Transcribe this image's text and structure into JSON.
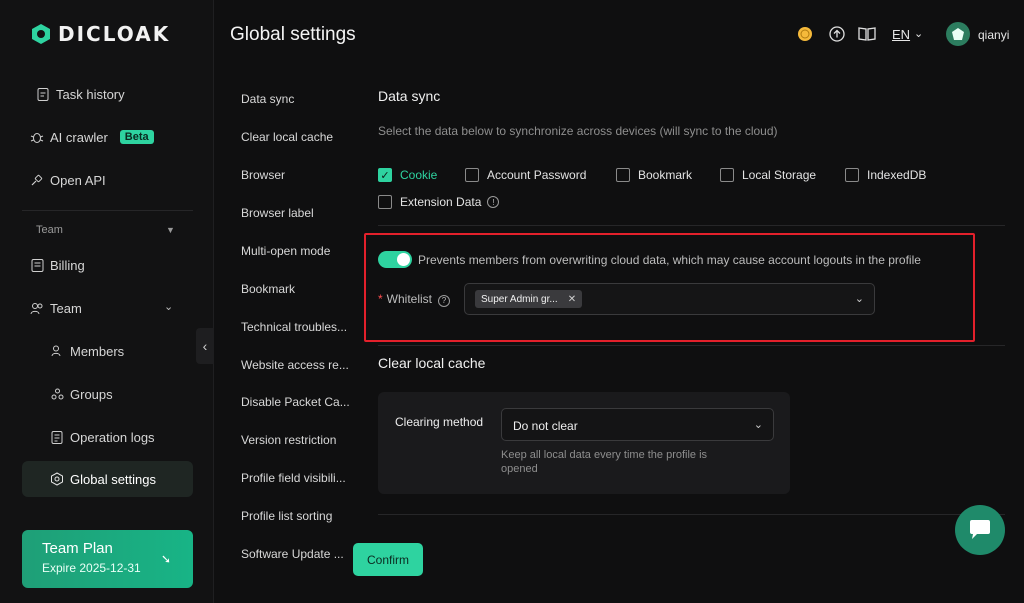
{
  "app": {
    "logo_text": "DICLOAK"
  },
  "sidebar": {
    "items": [
      {
        "label": "Task history"
      },
      {
        "label": "AI crawler",
        "badge": "Beta"
      },
      {
        "label": "Open API"
      }
    ],
    "section": "Team",
    "team_items": [
      {
        "label": "Billing"
      },
      {
        "label": "Team"
      },
      {
        "label": "Members"
      },
      {
        "label": "Groups"
      },
      {
        "label": "Operation logs"
      },
      {
        "label": "Global settings"
      }
    ],
    "plan": {
      "title": "Team Plan",
      "expire": "Expire 2025-12-31"
    }
  },
  "header": {
    "title": "Global settings",
    "language": "EN",
    "username": "qianyi"
  },
  "subnav": [
    "Data sync",
    "Clear local cache",
    "Browser",
    "Browser label",
    "Multi-open mode",
    "Bookmark",
    "Technical troubles...",
    "Website access re...",
    "Disable Packet Ca...",
    "Version restriction",
    "Profile field visibili...",
    "Profile list sorting",
    "Software Update ..."
  ],
  "data_sync": {
    "title": "Data sync",
    "description": "Select the data below to synchronize across devices (will sync to the cloud)",
    "options": [
      {
        "label": "Cookie",
        "checked": true
      },
      {
        "label": "Account Password",
        "checked": false
      },
      {
        "label": "Bookmark",
        "checked": false
      },
      {
        "label": "Local Storage",
        "checked": false
      },
      {
        "label": "IndexedDB",
        "checked": false
      },
      {
        "label": "Extension Data",
        "checked": false
      }
    ],
    "toggle_label": "Prevents members from overwriting cloud data, which may cause account logouts in the profile",
    "whitelist_label": "Whitelist",
    "whitelist_tag": "Super Admin gr..."
  },
  "clear_cache": {
    "title": "Clear local cache",
    "method_label": "Clearing method",
    "method_value": "Do not clear",
    "help": "Keep all local data every time the profile is opened"
  },
  "actions": {
    "confirm": "Confirm"
  },
  "colors": {
    "accent": "#2ed3a0",
    "highlight": "#e3202b"
  }
}
